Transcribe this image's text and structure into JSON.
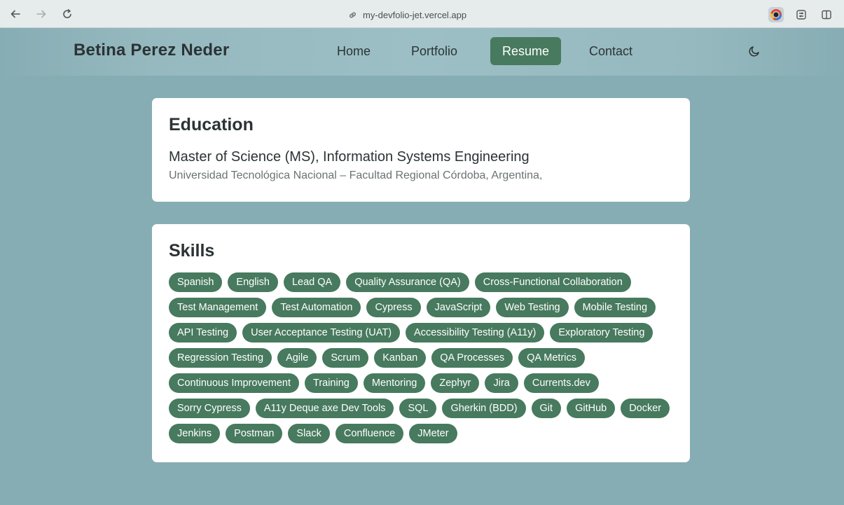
{
  "browser": {
    "url": "my-devfolio-jet.vercel.app"
  },
  "header": {
    "brand": "Betina Perez Neder",
    "nav": [
      {
        "label": "Home"
      },
      {
        "label": "Portfolio"
      },
      {
        "label": "Resume",
        "active": true
      },
      {
        "label": "Contact"
      }
    ],
    "theme_icon": "moon-icon"
  },
  "education": {
    "title": "Education",
    "degree": "Master of Science (MS), Information Systems Engineering",
    "school": "Universidad Tecnológica Nacional – Facultad Regional Córdoba, Argentina,"
  },
  "skills": {
    "title": "Skills",
    "items": [
      "Spanish",
      "English",
      "Lead QA",
      "Quality Assurance (QA)",
      "Cross-Functional Collaboration",
      "Test Management",
      "Test Automation",
      "Cypress",
      "JavaScript",
      "Web Testing",
      "Mobile Testing",
      "API Testing",
      "User Acceptance Testing (UAT)",
      "Accessibility Testing (A11y)",
      "Exploratory Testing",
      "Regression Testing",
      "Agile",
      "Scrum",
      "Kanban",
      "QA Processes",
      "QA Metrics",
      "Continuous Improvement",
      "Training",
      "Mentoring",
      "Zephyr",
      "Jira",
      "Currents.dev",
      "Sorry Cypress",
      "A11y Deque axe Dev Tools",
      "SQL",
      "Gherkin (BDD)",
      "Git",
      "GitHub",
      "Docker",
      "Jenkins",
      "Postman",
      "Slack",
      "Confluence",
      "JMeter"
    ]
  },
  "colors": {
    "background": "#87adb4",
    "accent": "#477a5e",
    "card": "#ffffff"
  }
}
